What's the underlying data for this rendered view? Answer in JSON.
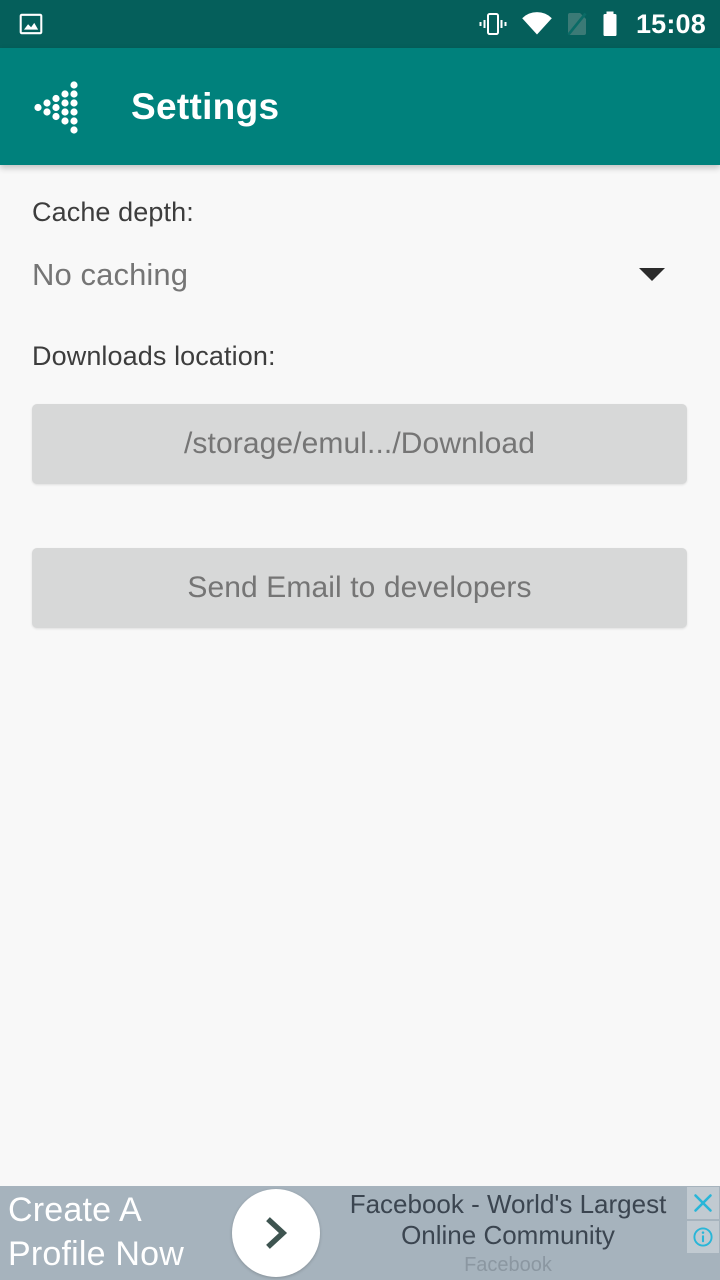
{
  "status_bar": {
    "background_color": "#055F5B",
    "notification_icon": "image-icon",
    "icons": [
      "vibrate-icon",
      "wifi-icon",
      "no-sim-icon",
      "battery-icon"
    ],
    "clock": "15:08"
  },
  "app_bar": {
    "background_color": "#00817C",
    "logo_icon": "dotted-left-arrow-logo",
    "title": "Settings"
  },
  "settings": {
    "cache_depth": {
      "label": "Cache depth:",
      "selected_value": "No caching",
      "caret_icon": "chevron-down-icon"
    },
    "downloads_location": {
      "label": "Downloads location:",
      "button_value": "/storage/emul.../Download"
    },
    "send_email_button": "Send Email to developers",
    "button_color": "#D7D8D8",
    "button_text_color": "#757575",
    "background_color": "#F8F8F8"
  },
  "ad": {
    "background_color": "#A6B3BD",
    "headline_line1": "Create A",
    "headline_line2": "Profile Now",
    "cta_icon": "chevron-right-icon",
    "title_line1": "Facebook - World's Largest",
    "title_line2": "Online Community",
    "advertiser": "Facebook",
    "close_icon": "close-icon",
    "info_icon": "info-icon",
    "control_color": "#29B6D8"
  }
}
